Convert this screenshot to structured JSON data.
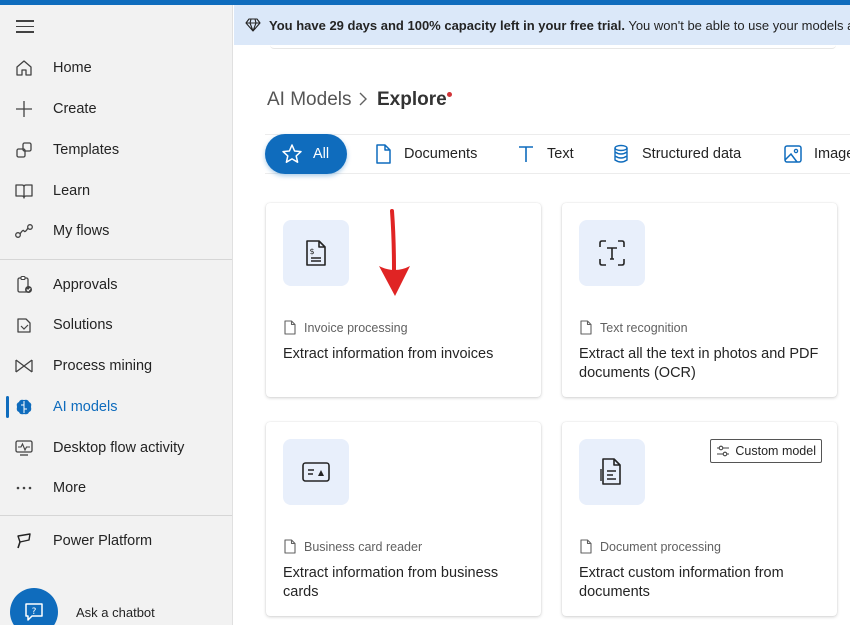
{
  "sidebar": {
    "items": [
      {
        "label": "Home"
      },
      {
        "label": "Create"
      },
      {
        "label": "Templates"
      },
      {
        "label": "Learn"
      },
      {
        "label": "My flows"
      },
      {
        "label": "Approvals"
      },
      {
        "label": "Solutions"
      },
      {
        "label": "Process mining"
      },
      {
        "label": "AI models"
      },
      {
        "label": "Desktop flow activity"
      },
      {
        "label": "More"
      },
      {
        "label": "Power Platform"
      }
    ],
    "active_item": "AI models",
    "chatbot_label": "Ask a chatbot"
  },
  "banner": {
    "bold_text": "You have 29 days and 100% capacity left in your free trial.",
    "rest_text": " You won't be able to use your models after yo"
  },
  "breadcrumb": {
    "parent": "AI Models",
    "current": "Explore"
  },
  "tabs": [
    {
      "label": "All",
      "icon": "star-icon"
    },
    {
      "label": "Documents",
      "icon": "document-icon"
    },
    {
      "label": "Text",
      "icon": "text-icon"
    },
    {
      "label": "Structured data",
      "icon": "database-icon"
    },
    {
      "label": "Image",
      "icon": "image-icon"
    }
  ],
  "cards": [
    {
      "category": "Invoice processing",
      "title": "Extract information from invoices",
      "icon": "invoice-icon"
    },
    {
      "category": "Text recognition",
      "title": "Extract all the text in photos and PDF documents (OCR)",
      "icon": "text-recognition-icon"
    },
    {
      "category": "Business card reader",
      "title": "Extract information from business cards",
      "icon": "business-card-icon"
    },
    {
      "category": "Document processing",
      "title": "Extract custom information from documents",
      "icon": "document-processing-icon",
      "badge": "Custom model"
    }
  ],
  "colors": {
    "accent": "#0f6cbd",
    "banner_bg": "#dbe8f9",
    "tile_bg": "#e8effb",
    "annotation": "#e02424"
  }
}
